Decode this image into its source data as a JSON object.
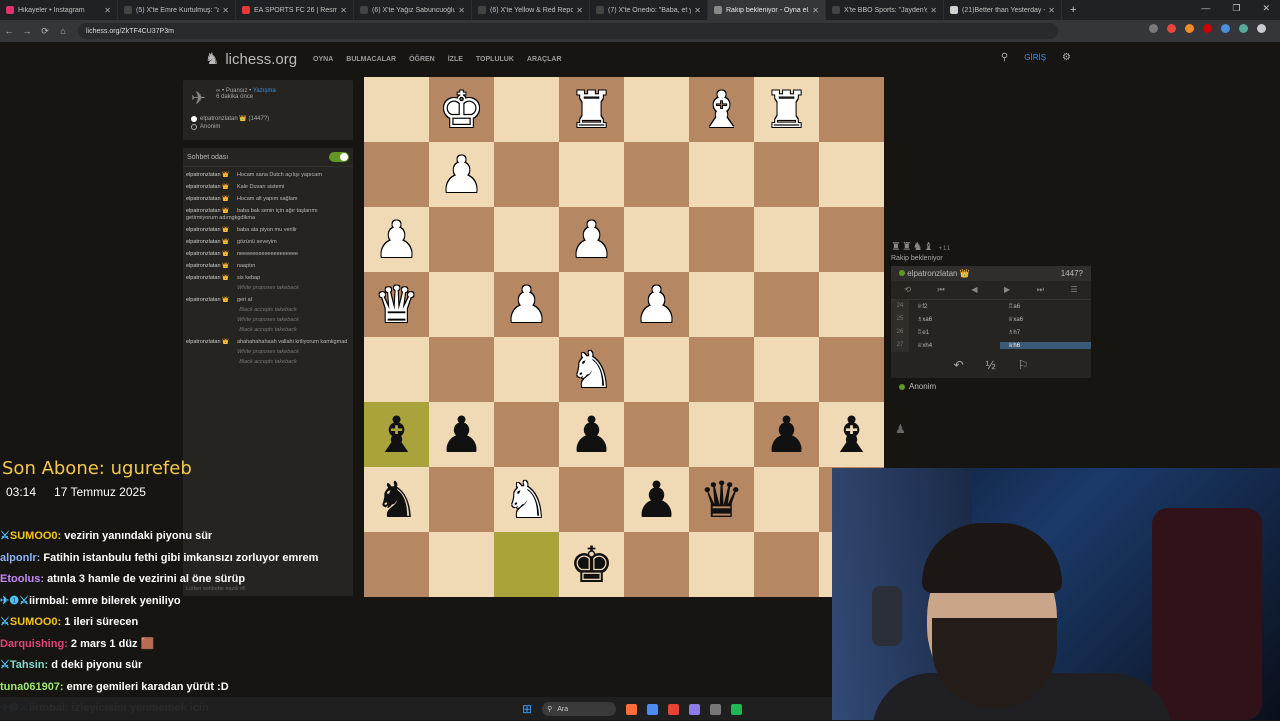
{
  "browser": {
    "tabs": [
      {
        "title": "Hikayeler • Instagram",
        "color": "#e1306c"
      },
      {
        "title": "(5) X'te Emre Kurtulmuş: \"akıllı...",
        "color": "#444"
      },
      {
        "title": "EA SPORTS FC 26 | Resmi Tanıtı...",
        "color": "#e53935"
      },
      {
        "title": "(6) X'te Yağız Sabuncuoğlu: \"Cu...",
        "color": "#444"
      },
      {
        "title": "(6) X'te Yellow & Red Report 🟡...",
        "color": "#444"
      },
      {
        "title": "(7) X'te Onedio: \"Baba, et yok!...",
        "color": "#444"
      },
      {
        "title": "Rakip bekleniyor - Oyna el...",
        "color": "#888",
        "active": true
      },
      {
        "title": "X'te BBO Sports: \"Jayden'e bai...",
        "color": "#444"
      },
      {
        "title": "(21)Better than Yesterday - Daı...",
        "color": "#d0d0d0"
      }
    ],
    "url": "lichess.org/ZkTF4CU37P3m",
    "nav_back": "←",
    "nav_forward": "→",
    "nav_reload": "⟳",
    "nav_home": "⌂",
    "new_tab": "+",
    "win_min": "—",
    "win_max": "❐",
    "win_close": "✕"
  },
  "lichess": {
    "logo": "lichess.org",
    "logo_icon": "♞",
    "nav": [
      "OYNA",
      "BULMACALAR",
      "ÖĞREN",
      "İZLE",
      "TOPLULUK",
      "ARAÇLAR"
    ],
    "search_icon": "⚲",
    "login": "GİRİŞ",
    "gear_icon": "⚙"
  },
  "gameinfo": {
    "icon": "✈",
    "line1_a": "∞ •",
    "line1_b": "Puansız •",
    "line1_c": "Yazışma",
    "line2": "6 dakika önce",
    "white_player": "elpatronzlatan 👑 (1447?)",
    "black_player": "Anonim"
  },
  "chat": {
    "title": "Sohbet odası",
    "messages": [
      {
        "user": "elpatronzlatan 👑",
        "text": "Hocam sana Dutch açılışı yapıcam"
      },
      {
        "user": "elpatronzlatan 👑",
        "text": "Kale Duvarı sistemi"
      },
      {
        "user": "elpatronzlatan 👑",
        "text": "Hocam alt yapım sağlam"
      },
      {
        "user": "elpatronzlatan 👑",
        "text": "baba bak senin için ağır taşlarımı getirmiyorum adımgkgdlkma"
      },
      {
        "user": "elpatronzlatan 👑",
        "text": "baba ata piyon mu verilir"
      },
      {
        "user": "elpatronzlatan 👑",
        "text": "gözünü seveyim"
      },
      {
        "user": "elpatronzlatan 👑",
        "text": "neeeeeeeeeeeeeeeeeee"
      },
      {
        "user": "elpatronzlatan 👑",
        "text": "naaptın"
      },
      {
        "user": "elpatronzlatan 👑",
        "text": "sis kebap"
      },
      {
        "system": "White proposes takeback"
      },
      {
        "user": "elpatronzlatan 👑",
        "text": "geri al"
      },
      {
        "system": "Black accepts takeback"
      },
      {
        "system": "White proposes takeback"
      },
      {
        "system": "Black accepts takeback"
      },
      {
        "user": "elpatronzlatan 👑",
        "text": "ahahahahahaah vallahi kriliyorum kamkgmad"
      },
      {
        "system": "White proposes takeback"
      },
      {
        "system": "Black accepts takeback"
      }
    ],
    "input_placeholder": "Lütfen sohbette nazik ol!"
  },
  "board": {
    "rows": [
      [
        "",
        "wK",
        "",
        "wR",
        "",
        "wB",
        "wR",
        ""
      ],
      [
        "",
        "wP",
        "",
        "",
        "",
        "",
        "",
        ""
      ],
      [
        "wP",
        "",
        "",
        "wP",
        "",
        "",
        "",
        ""
      ],
      [
        "wQ",
        "",
        "wP",
        "",
        "wP",
        "",
        "",
        ""
      ],
      [
        "",
        "",
        "",
        "wN",
        "",
        "",
        "",
        ""
      ],
      [
        "bB",
        "bP",
        "",
        "bP",
        "",
        "",
        "bP",
        "bB"
      ],
      [
        "bN",
        "",
        "wN",
        "",
        "bP",
        "bQ",
        "",
        ""
      ],
      [
        "",
        "",
        "",
        "bK",
        "",
        "",
        "",
        ""
      ]
    ],
    "highlight": [
      [
        5,
        0
      ],
      [
        7,
        2
      ]
    ],
    "glyphs": {
      "wK": "♚",
      "wQ": "♛",
      "wR": "♜",
      "wB": "♝",
      "wN": "♞",
      "wP": "♟",
      "bK": "♚",
      "bQ": "♛",
      "bR": "♜",
      "bB": "♝",
      "bN": "♞",
      "bP": "♟"
    }
  },
  "panel": {
    "captured": "♜♜♞♝",
    "captured_plus": "+11",
    "waiting": "Rakip bekleniyor",
    "opponent": "elpatronzlatan 👑",
    "opponent_rating": "1447?",
    "controls": [
      "⟲",
      "⏮",
      "◀",
      "▶",
      "⏭",
      "☰"
    ],
    "moves": [
      {
        "n": "24",
        "w": "♕f2",
        "b": "♖a6"
      },
      {
        "n": "25",
        "w": "♗xa6",
        "b": "♕xa6"
      },
      {
        "n": "26",
        "w": "♖e1",
        "b": "♗h7"
      },
      {
        "n": "27",
        "w": "♕xh4",
        "b": "♕h6",
        "current": "b"
      }
    ],
    "action_takeback": "↶",
    "action_draw": "½",
    "action_resign": "⚐",
    "self_name": "Anonim",
    "spare_icon": "♟"
  },
  "stream": {
    "last_sub_label": "Son Abone:",
    "last_sub_name": "ugurefeb",
    "time": "03:14",
    "date": "17 Temmuz 2025",
    "chat": [
      {
        "user": "SUMOO0:",
        "text": "vezirin yanındaki piyonu sür",
        "color": "#f5c518",
        "badge": "⚔"
      },
      {
        "user": "alponlr:",
        "text": "Fatihin istanbulu fethi gibi imkansızı zorluyor emrem",
        "color": "#8ab4f8",
        "badge": ""
      },
      {
        "user": "Etoolus:",
        "text": "atınla 3 hamle de vezirini al öne sürüp",
        "color": "#c58af9",
        "badge": ""
      },
      {
        "user": "iirmbal:",
        "text": "emre bilerek yeniliyo",
        "color": "#ffffff",
        "badge": "✈❶⚔"
      },
      {
        "user": "SUMOO0:",
        "text": "1 ileri sürecen",
        "color": "#f5c518",
        "badge": "⚔"
      },
      {
        "user": "Darquishing:",
        "text": "2 mars 1 düz 🟫",
        "color": "#e0457b",
        "badge": ""
      },
      {
        "user": "Tahsin:",
        "text": "d deki piyonu sür",
        "color": "#7fdbca",
        "badge": "⚔"
      },
      {
        "user": "tuna061907:",
        "text": "emre gemileri karadan yürüt :D",
        "color": "#9fe870",
        "badge": ""
      },
      {
        "user": "iirmbal:",
        "text": "izleyicisini yenmemek icin",
        "color": "#ffffff",
        "badge": "✈❶⚔"
      }
    ]
  },
  "taskbar": {
    "start_icon": "⊞",
    "search_placeholder": "Ara",
    "search_icon": "⚲",
    "apps": [
      "#ff6d3b",
      "#4c8bf5",
      "#ea4335",
      "#8c7ae6",
      "#777",
      "#1db954"
    ]
  }
}
